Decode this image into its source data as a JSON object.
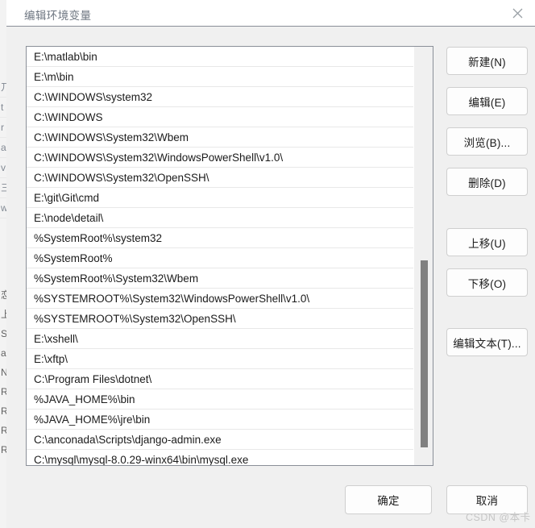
{
  "window": {
    "title": "编辑环境变量",
    "close_icon": "close-icon"
  },
  "path_list": {
    "entries": [
      "E:\\matlab\\bin",
      "E:\\m\\bin",
      "C:\\WINDOWS\\system32",
      "C:\\WINDOWS",
      "C:\\WINDOWS\\System32\\Wbem",
      "C:\\WINDOWS\\System32\\WindowsPowerShell\\v1.0\\",
      "C:\\WINDOWS\\System32\\OpenSSH\\",
      "E:\\git\\Git\\cmd",
      "E:\\node\\detail\\",
      "%SystemRoot%\\system32",
      "%SystemRoot%",
      "%SystemRoot%\\System32\\Wbem",
      "%SYSTEMROOT%\\System32\\WindowsPowerShell\\v1.0\\",
      "%SYSTEMROOT%\\System32\\OpenSSH\\",
      "E:\\xshell\\",
      "E:\\xftp\\",
      "C:\\Program Files\\dotnet\\",
      "%JAVA_HOME%\\bin",
      "%JAVA_HOME%\\jre\\bin",
      "C:\\anconada\\Scripts\\django-admin.exe",
      "C:\\mysql\\mysql-8.0.29-winx64\\bin\\mysql.exe",
      "",
      ""
    ]
  },
  "side_buttons": {
    "new": "新建(N)",
    "edit": "编辑(E)",
    "browse": "浏览(B)...",
    "delete": "删除(D)",
    "move_up": "上移(U)",
    "move_down": "下移(O)",
    "edit_text": "编辑文本(T)..."
  },
  "footer": {
    "ok": "确定",
    "cancel": "取消"
  },
  "watermark": "CSDN @本卡",
  "background_window": {
    "upper_fragments": [
      "丌",
      "t",
      "r",
      "a",
      "v",
      "三",
      "w"
    ],
    "lower_fragments": [
      "",
      "恋",
      "上",
      "S",
      "a",
      "N",
      "R",
      "R",
      "R",
      "R"
    ]
  },
  "colors": {
    "dialog_bg": "#f0f0f0",
    "titlebar_bg": "#ffffff",
    "title_text": "#6e7681",
    "list_bg": "#ffffff",
    "list_border": "#8a8f98",
    "row_text": "#1b1b1b",
    "row_divider": "#e8e8e8",
    "button_bg": "#fdfdfd",
    "button_border": "#cfcfcf",
    "scroll_thumb": "#808080",
    "watermark": "#c6c6c6"
  }
}
